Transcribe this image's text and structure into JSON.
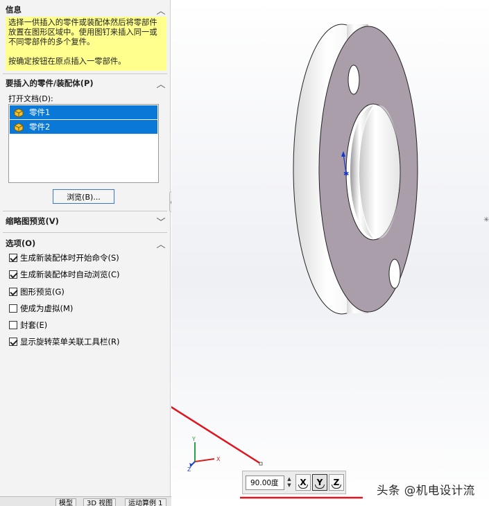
{
  "info": {
    "header": "信息",
    "line1": "选择一供插入的零件或装配体然后将零部件放置在图形区域中。使用图钉来插入同一或不同零部件的多个复件。",
    "line2": "按确定按钮在原点插入一零部件。"
  },
  "insert_section": {
    "header": "要插入的零件/装配体(P)",
    "open_docs_label": "打开文档(D):",
    "docs": [
      {
        "name": "零件1",
        "icon": "part-icon",
        "selected": true
      },
      {
        "name": "零件2",
        "icon": "part-icon",
        "selected": true
      }
    ],
    "browse_label": "浏览(B)..."
  },
  "preview_section": {
    "header": "缩略图预览(V)"
  },
  "options_section": {
    "header": "选项(O)",
    "items": [
      {
        "label": "生成新装配体时开始命令(S)",
        "checked": true
      },
      {
        "label": "生成新装配体时自动浏览(C)",
        "checked": true
      },
      {
        "label": "图形预览(G)",
        "checked": true
      },
      {
        "label": "使成为虚拟(M)",
        "checked": false
      },
      {
        "label": "封套(E)",
        "checked": false
      },
      {
        "label": "显示旋转菜单关联工具栏(R)",
        "checked": true
      }
    ]
  },
  "bottom_tabs": [
    "模型",
    "3D 视图",
    "运动算例 1"
  ],
  "triad": {
    "x": "X",
    "y": "Y",
    "z": "Z"
  },
  "rotate_toolbar": {
    "angle_value": "90.00度",
    "axes": [
      {
        "label": "X",
        "active": false
      },
      {
        "label": "Y",
        "active": true
      },
      {
        "label": "Z",
        "active": false
      }
    ]
  },
  "watermark": "头条 @机电设计流",
  "colors": {
    "selection": "#0a78d7",
    "info_bg": "#ffff8e",
    "annotation_red": "#e0141e",
    "part_face": "#a99eaa"
  }
}
